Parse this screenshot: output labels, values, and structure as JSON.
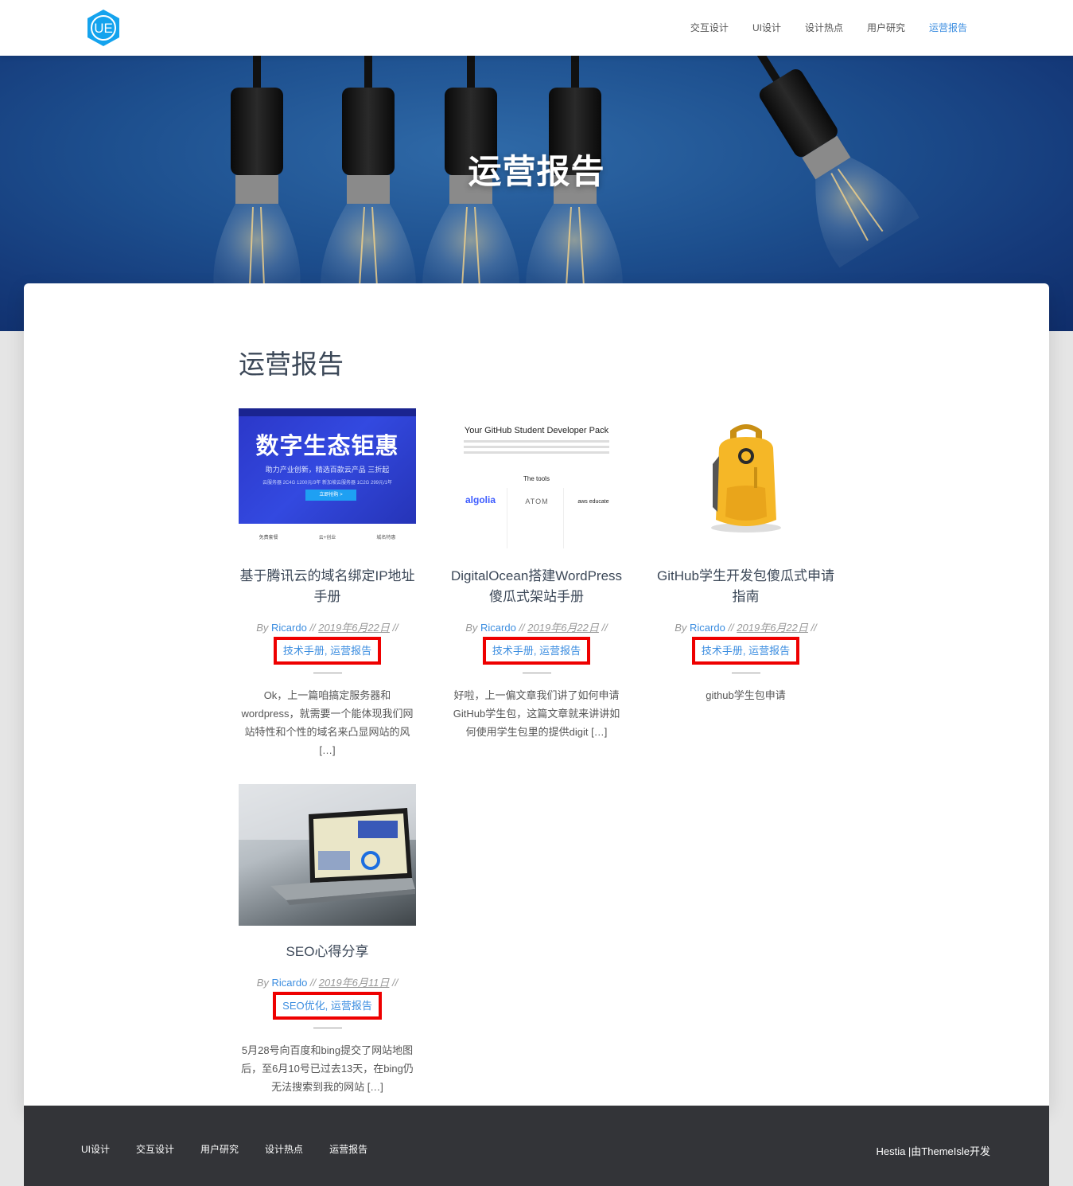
{
  "navbar": {
    "logo_text": "UE",
    "links": [
      "交互设计",
      "UI设计",
      "设计热点",
      "用户研究",
      "运营报告"
    ],
    "active_index": 4
  },
  "hero": {
    "title": "运营报告"
  },
  "main": {
    "page_title": "运营报告",
    "posts": [
      {
        "title": "基于腾讯云的域名绑定IP地址手册",
        "author_prefix": "By",
        "author": "Ricardo",
        "date": "2019年6月22日",
        "categories": "技术手册, 运营报告",
        "excerpt": "Ok，上一篇咱搞定服务器和wordpress，就需要一个能体现我们网站特性和个性的域名来凸显网站的风 […]",
        "thumb": {
          "headline": "数字生态钜惠",
          "subline": "助力产业创新，精选百款云产品 三折起",
          "small": "云服务器 2C4G 1200元/3年  新加坡云服务器 1C2G 299元/1年",
          "btn": "立即抢购 >",
          "tabs": [
            "免费套餐",
            "云+创业",
            "城名特惠"
          ]
        }
      },
      {
        "title": "DigitalOcean搭建WordPress傻瓜式架站手册",
        "author_prefix": "By",
        "author": "Ricardo",
        "date": "2019年6月22日",
        "categories": "技术手册, 运营报告",
        "excerpt": "好啦，上一偏文章我们讲了如何申请GitHub学生包，这篇文章就来讲讲如何使用学生包里的提供digit […]",
        "thumb": {
          "heading": "Your GitHub Student Developer Pack",
          "tools": "The tools",
          "brands": [
            "algolia",
            "ATOM",
            "aws educate"
          ]
        }
      },
      {
        "title": "GitHub学生开发包傻瓜式申请指南",
        "author_prefix": "By",
        "author": "Ricardo",
        "date": "2019年6月22日",
        "categories": "技术手册, 运营报告",
        "excerpt": "github学生包申请"
      },
      {
        "title": "SEO心得分享",
        "author_prefix": "By",
        "author": "Ricardo",
        "date": "2019年6月11日",
        "categories": "SEO优化, 运营报告",
        "excerpt": "5月28号向百度和bing提交了网站地图后，至6月10号已过去13天，在bing仍无法搜索到我的网站 […]"
      }
    ]
  },
  "footer": {
    "links": [
      "UI设计",
      "交互设计",
      "用户研究",
      "设计热点",
      "运营报告"
    ],
    "copyright": "Hestia |由ThemeIsle开发"
  }
}
